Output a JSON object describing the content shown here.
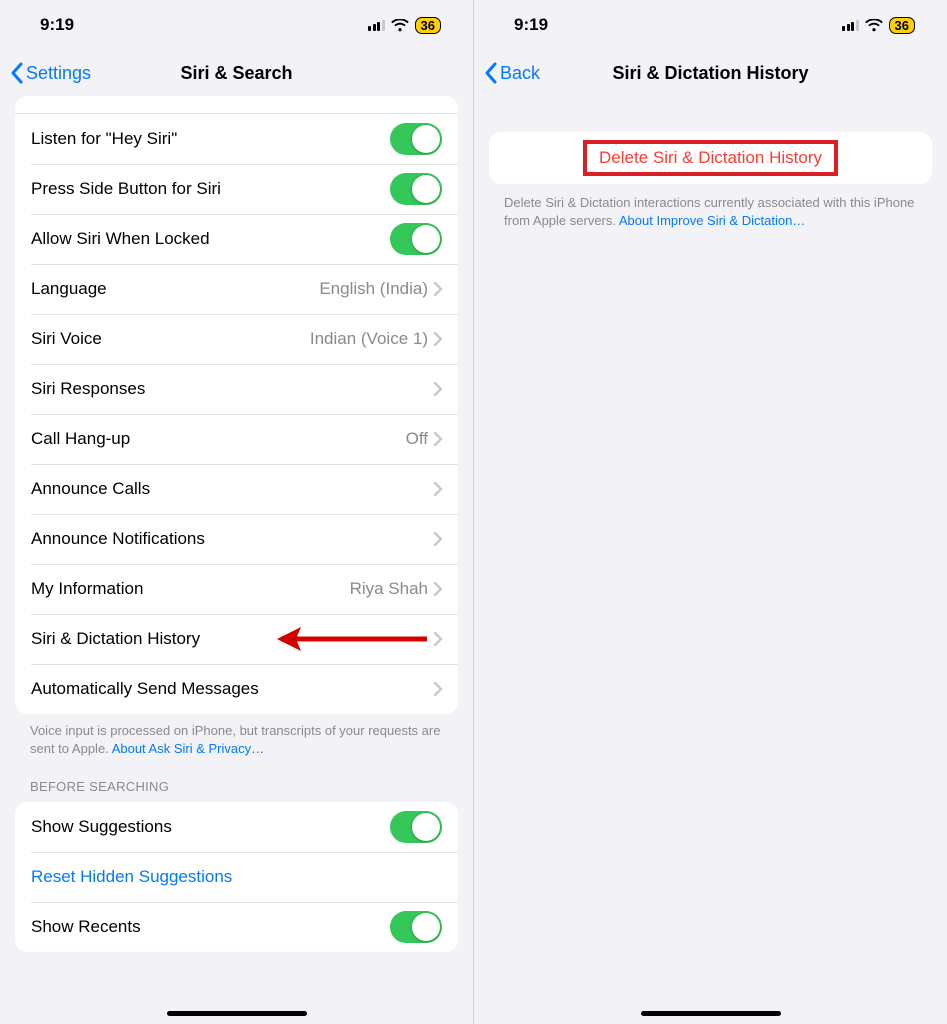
{
  "status": {
    "time": "9:19",
    "battery": "36"
  },
  "left": {
    "back": "Settings",
    "title": "Siri & Search",
    "rows": {
      "heysiri": "Listen for \"Hey Siri\"",
      "sidebtn": "Press Side Button for Siri",
      "locked": "Allow Siri When Locked",
      "language": "Language",
      "language_v": "English (India)",
      "voice": "Siri Voice",
      "voice_v": "Indian (Voice 1)",
      "responses": "Siri Responses",
      "hangup": "Call Hang-up",
      "hangup_v": "Off",
      "announce_calls": "Announce Calls",
      "announce_notif": "Announce Notifications",
      "myinfo": "My Information",
      "myinfo_v": "Riya Shah",
      "history": "Siri & Dictation History",
      "autosend": "Automatically Send Messages"
    },
    "footer1a": "Voice input is processed on iPhone, but transcripts of your requests are sent to Apple. ",
    "footer1b": "About Ask Siri & Privacy…",
    "section2": "BEFORE SEARCHING",
    "rows2": {
      "suggestions": "Show Suggestions",
      "reset": "Reset Hidden Suggestions",
      "recents": "Show Recents"
    }
  },
  "right": {
    "back": "Back",
    "title": "Siri & Dictation History",
    "delete": "Delete Siri & Dictation History",
    "footer_a": "Delete Siri & Dictation interactions currently associated with this iPhone from Apple servers. ",
    "footer_b": "About Improve Siri & Dictation…"
  }
}
